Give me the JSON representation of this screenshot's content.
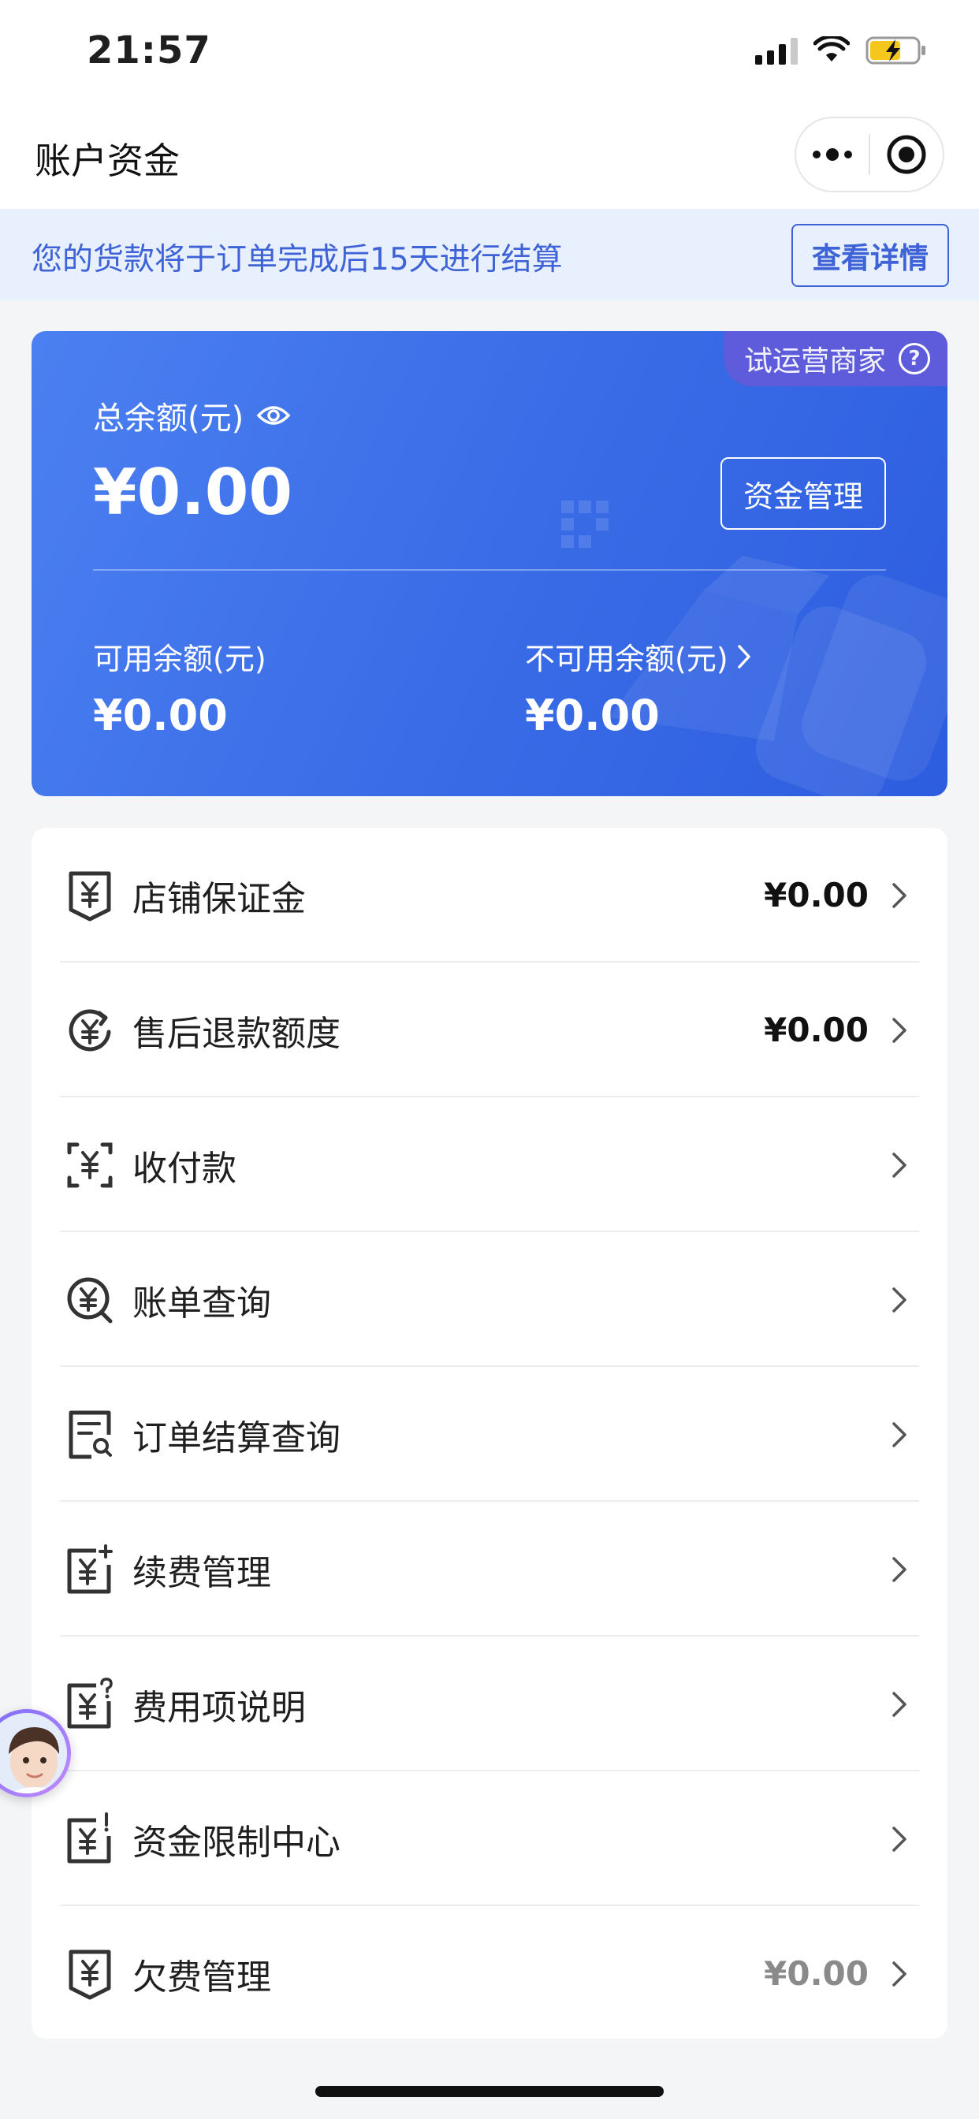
{
  "status_bar": {
    "time": "21:57"
  },
  "nav": {
    "title": "账户资金"
  },
  "notice": {
    "text": "您的货款将于订单完成后15天进行结算",
    "button_label": "查看详情"
  },
  "balance_card": {
    "tag": "试运营商家",
    "tag_help": "?",
    "total_label": "总余额(元)",
    "total_value": "¥0.00",
    "manage_label": "资金管理",
    "available_label": "可用余额(元)",
    "available_value": "¥0.00",
    "unavailable_label": "不可用余额(元)",
    "unavailable_value": "¥0.00"
  },
  "menu": {
    "items": [
      {
        "label": "店铺保证金",
        "amount": "¥0.00",
        "icon": "shield-yuan-icon"
      },
      {
        "label": "售后退款额度",
        "amount": "¥0.00",
        "icon": "refund-yuan-icon"
      },
      {
        "label": "收付款",
        "amount": "",
        "icon": "scan-yuan-icon"
      },
      {
        "label": "账单查询",
        "amount": "",
        "icon": "search-yuan-icon"
      },
      {
        "label": "订单结算查询",
        "amount": "",
        "icon": "document-search-icon"
      },
      {
        "label": "续费管理",
        "amount": "",
        "icon": "renew-yuan-icon"
      },
      {
        "label": "费用项说明",
        "amount": "",
        "icon": "fee-info-icon"
      },
      {
        "label": "资金限制中心",
        "amount": "",
        "icon": "restriction-yuan-icon"
      },
      {
        "label": "欠费管理",
        "amount": "¥0.00",
        "icon": "arrears-shield-icon"
      }
    ]
  },
  "colors": {
    "accent": "#3e63d6",
    "card_start": "#4b80f1",
    "card_end": "#2d5ddf",
    "notice_bg": "#e8effd",
    "muted_amount": "#8a8a8a"
  }
}
